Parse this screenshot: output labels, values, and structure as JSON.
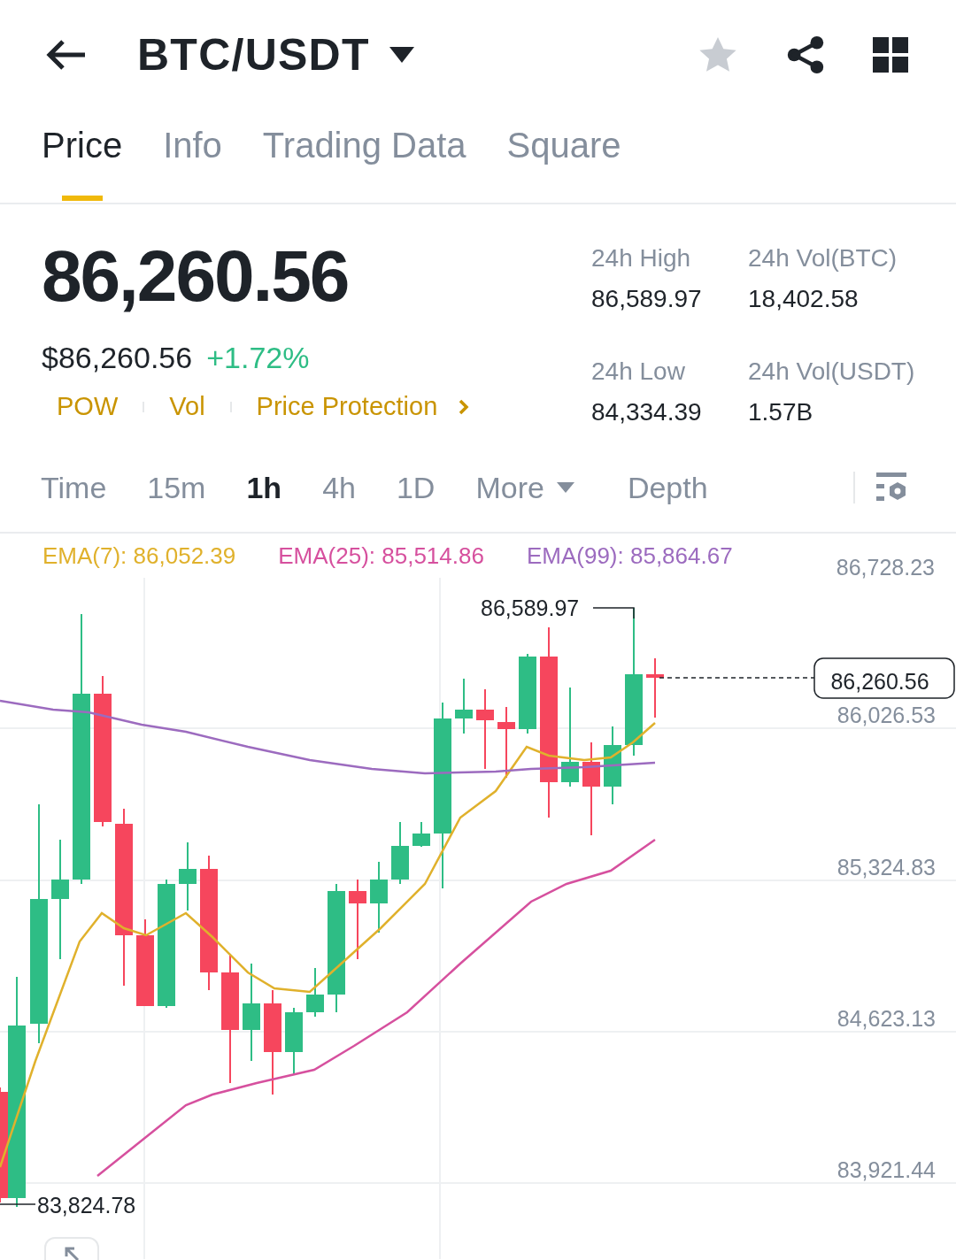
{
  "header": {
    "pair": "BTC/USDT",
    "favorite": false
  },
  "tabs": [
    {
      "label": "Price",
      "selected": true
    },
    {
      "label": "Info",
      "selected": false
    },
    {
      "label": "Trading Data",
      "selected": false
    },
    {
      "label": "Square",
      "selected": false
    }
  ],
  "price": {
    "last": "86,260.56",
    "usd": "$86,260.56",
    "change": "+1.72%"
  },
  "tags": [
    "POW",
    "Vol",
    "Price Protection"
  ],
  "stats": [
    {
      "label": "24h High",
      "value": "86,589.97"
    },
    {
      "label": "24h Vol(BTC)",
      "value": "18,402.58"
    },
    {
      "label": "24h Low",
      "value": "84,334.39"
    },
    {
      "label": "24h Vol(USDT)",
      "value": "1.57B"
    }
  ],
  "intervals": [
    {
      "label": "Time",
      "selected": false,
      "kind": "plain"
    },
    {
      "label": "15m",
      "selected": false,
      "kind": "plain"
    },
    {
      "label": "1h",
      "selected": true,
      "kind": "plain"
    },
    {
      "label": "4h",
      "selected": false,
      "kind": "plain"
    },
    {
      "label": "1D",
      "selected": false,
      "kind": "plain"
    },
    {
      "label": "More",
      "selected": false,
      "kind": "menu"
    },
    {
      "label": "Depth",
      "selected": false,
      "kind": "plain"
    }
  ],
  "indicators": [
    {
      "label": "EMA(7): 86,052.39",
      "color": "#e0b12c"
    },
    {
      "label": "EMA(25): 85,514.86",
      "color": "#d6509e"
    },
    {
      "label": "EMA(99): 85,864.67",
      "color": "#9c6bbf"
    }
  ],
  "chart": {
    "price_axis": [
      "86,728.23",
      "86,026.53",
      "85,324.83",
      "84,623.13",
      "83,921.44"
    ],
    "current_price": "86,260.56",
    "high_marker": "86,589.97",
    "low_marker": "83,824.78"
  }
}
